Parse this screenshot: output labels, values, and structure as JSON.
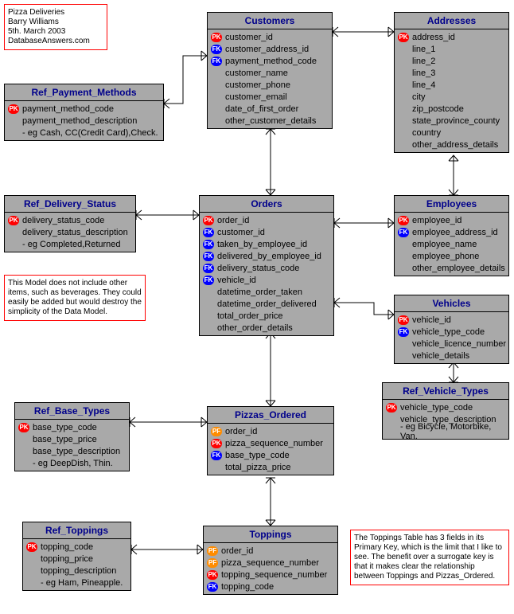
{
  "meta": {
    "title": "Pizza Deliveries",
    "author": "Barry Williams",
    "date": "5th. March 2003",
    "site": "DatabaseAnswers.com"
  },
  "notes": {
    "model_note": "This Model does not include other items, such as beverages. They could easily be added but would destroy the simplicity of the Data Model.",
    "toppings_note": "The Toppings Table has 3 fields in its Primary Key, which is the limit that I like to see. The benefit over a surrogate key is that it makes clear the relationship between Toppings and Pizzas_Ordered."
  },
  "entities": {
    "customers": {
      "name": "Customers",
      "attrs": [
        {
          "key": "PK",
          "name": "customer_id"
        },
        {
          "key": "FK",
          "name": "customer_address_id"
        },
        {
          "key": "FK",
          "name": "payment_method_code"
        },
        {
          "key": "",
          "name": "customer_name"
        },
        {
          "key": "",
          "name": "customer_phone"
        },
        {
          "key": "",
          "name": "customer_email"
        },
        {
          "key": "",
          "name": "date_of_first_order"
        },
        {
          "key": "",
          "name": "other_customer_details"
        }
      ]
    },
    "addresses": {
      "name": "Addresses",
      "attrs": [
        {
          "key": "PK",
          "name": "address_id"
        },
        {
          "key": "",
          "name": "line_1"
        },
        {
          "key": "",
          "name": "line_2"
        },
        {
          "key": "",
          "name": "line_3"
        },
        {
          "key": "",
          "name": "line_4"
        },
        {
          "key": "",
          "name": "city"
        },
        {
          "key": "",
          "name": "zip_postcode"
        },
        {
          "key": "",
          "name": "state_province_county"
        },
        {
          "key": "",
          "name": "country"
        },
        {
          "key": "",
          "name": "other_address_details"
        }
      ]
    },
    "ref_payment_methods": {
      "name": "Ref_Payment_Methods",
      "attrs": [
        {
          "key": "PK",
          "name": "payment_method_code"
        },
        {
          "key": "",
          "name": "payment_method_description"
        },
        {
          "key": "",
          "name": "- eg Cash, CC(Credit Card),Check."
        }
      ]
    },
    "ref_delivery_status": {
      "name": "Ref_Delivery_Status",
      "attrs": [
        {
          "key": "PK",
          "name": "delivery_status_code"
        },
        {
          "key": "",
          "name": "delivery_status_description"
        },
        {
          "key": "",
          "name": "- eg Completed,Returned"
        }
      ]
    },
    "orders": {
      "name": "Orders",
      "attrs": [
        {
          "key": "PK",
          "name": "order_id"
        },
        {
          "key": "FK",
          "name": "customer_id"
        },
        {
          "key": "FK",
          "name": "taken_by_employee_id"
        },
        {
          "key": "FK",
          "name": "delivered_by_employee_id"
        },
        {
          "key": "FK",
          "name": "delivery_status_code"
        },
        {
          "key": "FK",
          "name": "vehicle_id"
        },
        {
          "key": "",
          "name": "datetime_order_taken"
        },
        {
          "key": "",
          "name": "datetime_order_delivered"
        },
        {
          "key": "",
          "name": "total_order_price"
        },
        {
          "key": "",
          "name": "other_order_details"
        }
      ]
    },
    "employees": {
      "name": "Employees",
      "attrs": [
        {
          "key": "PK",
          "name": "employee_id"
        },
        {
          "key": "FK",
          "name": "employee_address_id"
        },
        {
          "key": "",
          "name": "employee_name"
        },
        {
          "key": "",
          "name": "employee_phone"
        },
        {
          "key": "",
          "name": "other_employee_details"
        }
      ]
    },
    "vehicles": {
      "name": "Vehicles",
      "attrs": [
        {
          "key": "PK",
          "name": "vehicle_id"
        },
        {
          "key": "FK",
          "name": "vehicle_type_code"
        },
        {
          "key": "",
          "name": "vehicle_licence_number"
        },
        {
          "key": "",
          "name": "vehicle_details"
        }
      ]
    },
    "ref_vehicle_types": {
      "name": "Ref_Vehicle_Types",
      "attrs": [
        {
          "key": "PK",
          "name": "vehicle_type_code"
        },
        {
          "key": "",
          "name": "vehicle_type_description"
        },
        {
          "key": "",
          "name": "- eg Bicycle, Motorbike, Van."
        }
      ]
    },
    "ref_base_types": {
      "name": "Ref_Base_Types",
      "attrs": [
        {
          "key": "PK",
          "name": "base_type_code"
        },
        {
          "key": "",
          "name": "base_type_price"
        },
        {
          "key": "",
          "name": "base_type_description"
        },
        {
          "key": "",
          "name": "- eg DeepDish, Thin."
        }
      ]
    },
    "pizzas_ordered": {
      "name": "Pizzas_Ordered",
      "attrs": [
        {
          "key": "PF",
          "name": "order_id"
        },
        {
          "key": "PK",
          "name": "pizza_sequence_number"
        },
        {
          "key": "FK",
          "name": "base_type_code"
        },
        {
          "key": "",
          "name": "total_pizza_price"
        }
      ]
    },
    "ref_toppings": {
      "name": "Ref_Toppings",
      "attrs": [
        {
          "key": "PK",
          "name": "topping_code"
        },
        {
          "key": "",
          "name": "topping_price"
        },
        {
          "key": "",
          "name": "topping_description"
        },
        {
          "key": "",
          "name": "- eg Ham, Pineapple."
        }
      ]
    },
    "toppings": {
      "name": "Toppings",
      "attrs": [
        {
          "key": "PF",
          "name": "order_id"
        },
        {
          "key": "PF",
          "name": "pizza_sequence_number"
        },
        {
          "key": "PK",
          "name": "topping_sequence_number"
        },
        {
          "key": "FK",
          "name": "topping_code"
        }
      ]
    }
  }
}
